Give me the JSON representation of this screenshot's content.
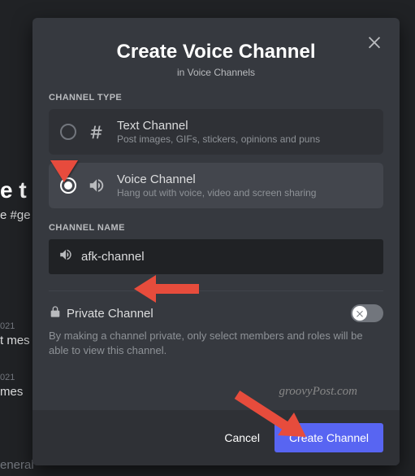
{
  "background": {
    "heading_fragment": "e t",
    "hash_channel_fragment": "e #ge",
    "date_fragment": "021",
    "msg_fragment_1": "t mes",
    "msg_fragment_2": "mes",
    "bottom_fragment": "eneral"
  },
  "modal": {
    "title": "Create Voice Channel",
    "subtitle": "in Voice Channels",
    "section_type_label": "CHANNEL TYPE",
    "types": [
      {
        "title": "Text Channel",
        "desc": "Post images, GIFs, stickers, opinions and puns",
        "selected": false
      },
      {
        "title": "Voice Channel",
        "desc": "Hang out with voice, video and screen sharing",
        "selected": true
      }
    ],
    "section_name_label": "CHANNEL NAME",
    "channel_name_value": "afk-channel",
    "private": {
      "label": "Private Channel",
      "desc": "By making a channel private, only select members and roles will be able to view this channel.",
      "enabled": false
    },
    "buttons": {
      "cancel": "Cancel",
      "create": "Create Channel"
    }
  },
  "watermark": "groovyPost.com"
}
